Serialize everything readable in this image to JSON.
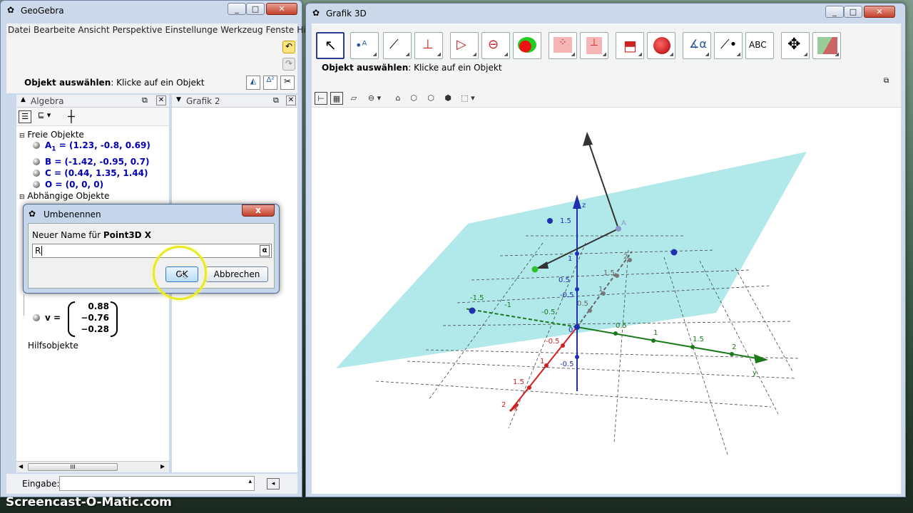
{
  "left_window": {
    "title": "GeoGebra",
    "menu": [
      "Datei",
      "Bearbeite",
      "Ansicht",
      "Perspektive",
      "Einstellunge",
      "Werkzeug",
      "Fenste",
      "Hilfe"
    ],
    "mode_bold": "Objekt auswählen",
    "mode_text": ": Klicke auf ein Objekt",
    "algebra_title": "Algebra",
    "graphics2_title": "Grafik 2",
    "free_header": "Freie Objekte",
    "free_items": [
      {
        "label": "A",
        "sub": "1",
        "rest": " = (1.23, -0.8, 0.69)"
      },
      {
        "label": "B = (-1.42, -0.95, 0.7)"
      },
      {
        "label": "C = (0.44, 1.35, 1.44)"
      },
      {
        "label": "O = (0, 0, 0)"
      }
    ],
    "dependent_header": "Abhängige Objekte",
    "vector_name": "v =",
    "vector_values": [
      "0.88",
      "−0.76",
      "−0.28"
    ],
    "aux_header": "Hilfsobjekte",
    "input_label": "Eingabe:",
    "input_value": "",
    "scroll_mark": "III"
  },
  "dialog": {
    "title": "Umbenennen",
    "prompt": "Neuer Name für ",
    "prompt_bold": "Point3D X",
    "value": "R",
    "alpha": "α",
    "ok": "OK",
    "cancel": "Abbrechen",
    "close": "x"
  },
  "right_window": {
    "title": "Grafik 3D",
    "mode_bold": "Objekt auswählen",
    "mode_text": ": Klicke auf ein Objekt",
    "abc_tool": "ABC",
    "axis_labels": {
      "x": "x",
      "y": "y",
      "z": "z"
    },
    "point_label": "A",
    "ticks_z": [
      "1.5",
      "1",
      "0.5",
      "-0.5",
      "0"
    ],
    "ticks_y": [
      "0.5",
      "1",
      "1.5",
      "2"
    ],
    "ticks_x": [
      "-0.5",
      "1",
      "1.5",
      "2"
    ],
    "ticks_neg_y": [
      "-1.5",
      "-1",
      "-0.5"
    ],
    "ticks_gray": [
      "2",
      "1.5",
      "1",
      "0.5"
    ]
  },
  "watermark": "Screencast-O-Matic.com",
  "colors": {
    "accent": "#2a3e8e",
    "plane": "#9ee3e6",
    "axis_x": "#d02020",
    "axis_y": "#1a7a1a",
    "axis_z": "#1f2fb0"
  }
}
